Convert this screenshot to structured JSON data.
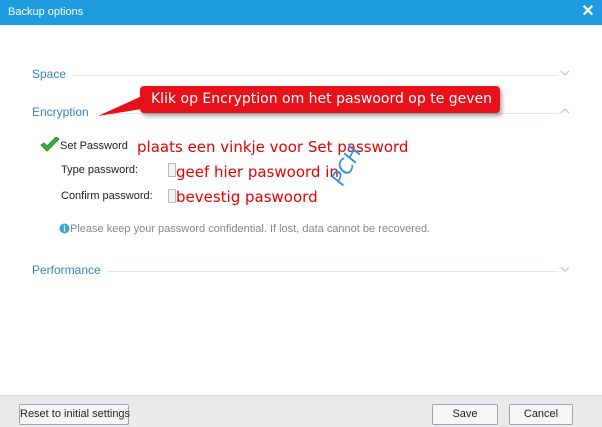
{
  "window": {
    "title": "Backup options",
    "close_symbol": "✕"
  },
  "sections": {
    "space": {
      "label": "Space",
      "state": "collapsed"
    },
    "encryption": {
      "label": "Encryption",
      "state": "expanded"
    },
    "performance": {
      "label": "Performance",
      "state": "collapsed"
    }
  },
  "encryption_panel": {
    "set_password_label": "Set Password",
    "set_password_checked": true,
    "type_password_label": "Type password:",
    "type_password_value": "",
    "confirm_password_label": "Confirm password:",
    "confirm_password_value": "",
    "info_text": "Please keep your password confidential. If lost, data cannot be recovered."
  },
  "annotations": {
    "callout": "Klik op Encryption om het paswoord op te geven",
    "set_password_note": "plaats een vinkje voor Set password",
    "type_password_note": "geef hier paswoord in",
    "confirm_password_note": "bevestig paswoord",
    "watermark": "PCH"
  },
  "buttons": {
    "reset": "Reset to initial settings",
    "save": "Save",
    "cancel": "Cancel"
  },
  "colors": {
    "titlebar": "#1e9ce0",
    "section_label": "#3d7fbf",
    "annotation": "#e60000",
    "callout_bg": "#e8111a",
    "watermark": "#2f8fe0",
    "check": "#3cb043"
  },
  "icons": {
    "close": "close-icon",
    "chevron_down": "chevron-down-icon",
    "chevron_up": "chevron-up-icon",
    "check": "checkmark-icon",
    "info": "info-icon"
  }
}
